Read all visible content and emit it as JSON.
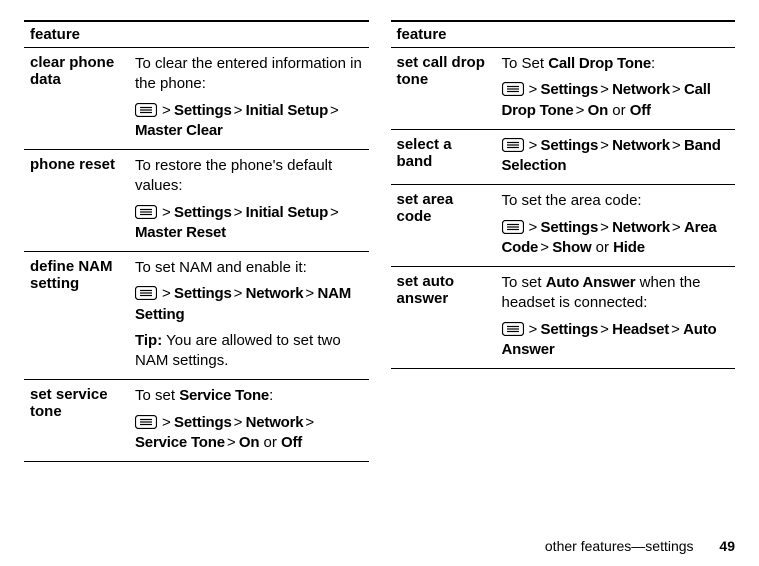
{
  "header": {
    "feature_label": "feature"
  },
  "left": [
    {
      "name": "clear phone data",
      "intro": "To clear the entered information in the phone:",
      "path": [
        "Settings",
        "Initial Setup",
        "Master Clear"
      ]
    },
    {
      "name": "phone reset",
      "intro": "To restore the phone's default values:",
      "path": [
        "Settings",
        "Initial Setup",
        "Master Reset"
      ]
    },
    {
      "name": "define NAM setting",
      "intro": "To set NAM and enable it:",
      "path": [
        "Settings",
        "Network",
        "NAM Setting"
      ],
      "tip_label": "Tip:",
      "tip": "You are allowed to set two NAM settings."
    },
    {
      "name": "set service tone",
      "intro_pre": "To set ",
      "intro_bold": "Service Tone",
      "intro_post": ":",
      "path": [
        "Settings",
        "Network",
        "Service Tone"
      ],
      "tail_options": [
        "On",
        "Off"
      ],
      "tail_sep": " or "
    }
  ],
  "right": [
    {
      "name": "set call drop tone",
      "intro_pre": "To Set ",
      "intro_bold": "Call Drop Tone",
      "intro_post": ":",
      "path": [
        "Settings",
        "Network",
        "Call Drop Tone"
      ],
      "tail_options": [
        "On",
        "Off"
      ],
      "tail_sep": " or "
    },
    {
      "name": "select a band",
      "path": [
        "Settings",
        "Network",
        "Band Selection"
      ]
    },
    {
      "name": "set area code",
      "intro": "To set the area code:",
      "path": [
        "Settings",
        "Network",
        "Area Code"
      ],
      "tail_options": [
        "Show",
        "Hide"
      ],
      "tail_sep": " or "
    },
    {
      "name": "set auto answer",
      "intro_pre": "To set ",
      "intro_bold": "Auto Answer",
      "intro_post": " when the headset is connected:",
      "path": [
        "Settings",
        "Headset",
        "Auto Answer"
      ]
    }
  ],
  "footer": {
    "section": "other features—settings",
    "page": "49"
  }
}
